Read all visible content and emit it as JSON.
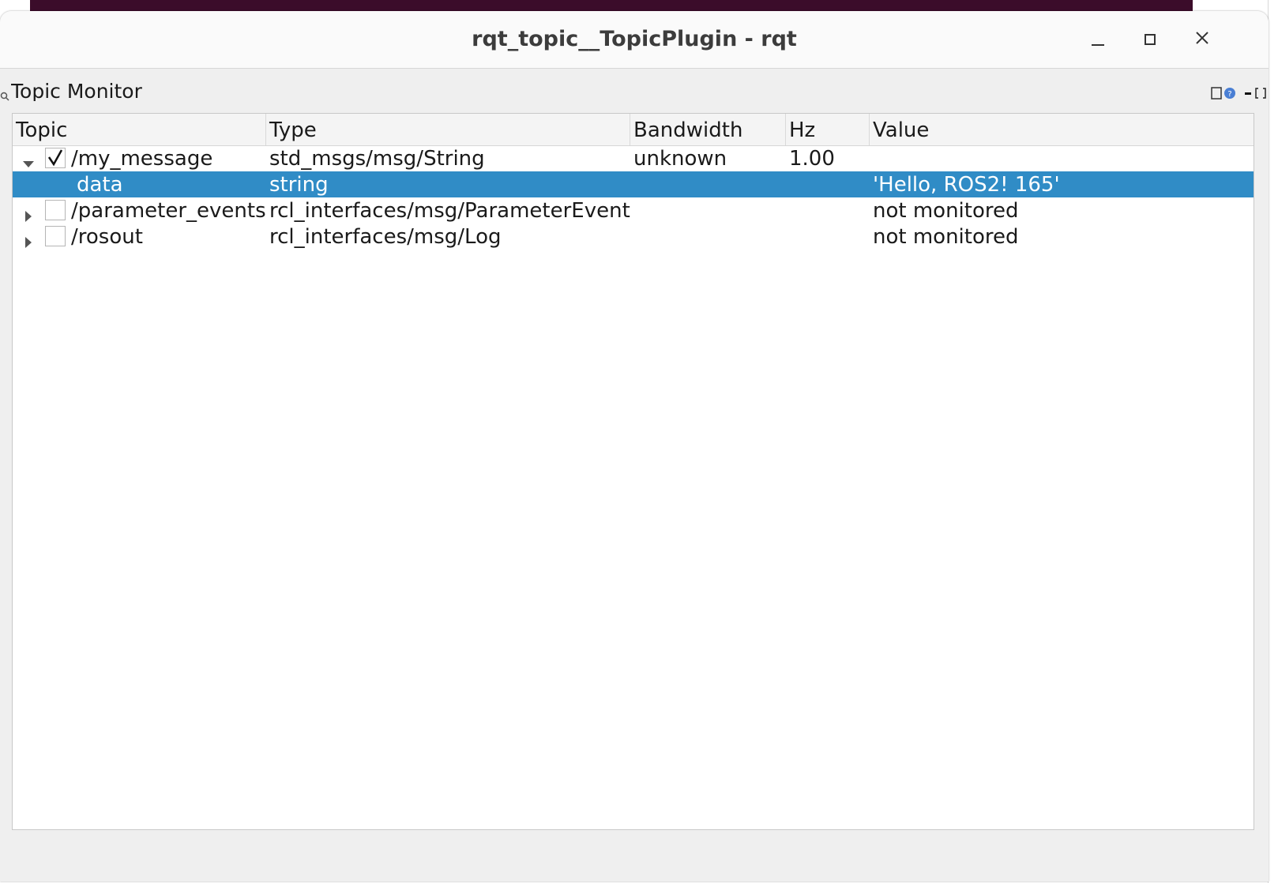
{
  "window": {
    "title": "rqt_topic__TopicPlugin - rqt",
    "minimize_icon": "minimize-icon",
    "maximize_icon": "maximize-icon",
    "close_icon": "close-icon"
  },
  "dock": {
    "title": "Topic Monitor",
    "icon": "magnifier-icon",
    "buttons": [
      "help-icon",
      "minimize-icon",
      "float-icon"
    ]
  },
  "tree": {
    "columns": [
      "Topic",
      "Type",
      "Bandwidth",
      "Hz",
      "Value"
    ],
    "rows": [
      {
        "topic": "/my_message",
        "type": "std_msgs/msg/String",
        "bandwidth": "unknown",
        "hz": "1.00",
        "value": "",
        "expanded": true,
        "checked": true,
        "child": false,
        "selected": false
      },
      {
        "topic": "data",
        "type": "string",
        "bandwidth": "",
        "hz": "",
        "value": "'Hello, ROS2! 165'",
        "expanded": false,
        "checked": false,
        "child": true,
        "selected": true
      },
      {
        "topic": "/parameter_events",
        "type": "rcl_interfaces/msg/ParameterEvent",
        "bandwidth": "",
        "hz": "",
        "value": "not monitored",
        "expanded": false,
        "checked": false,
        "child": false,
        "selected": false
      },
      {
        "topic": "/rosout",
        "type": "rcl_interfaces/msg/Log",
        "bandwidth": "",
        "hz": "",
        "value": "not monitored",
        "expanded": false,
        "checked": false,
        "child": false,
        "selected": false
      }
    ]
  },
  "colors": {
    "selection": "#308cc6",
    "desktop": "#3b0c2a"
  }
}
